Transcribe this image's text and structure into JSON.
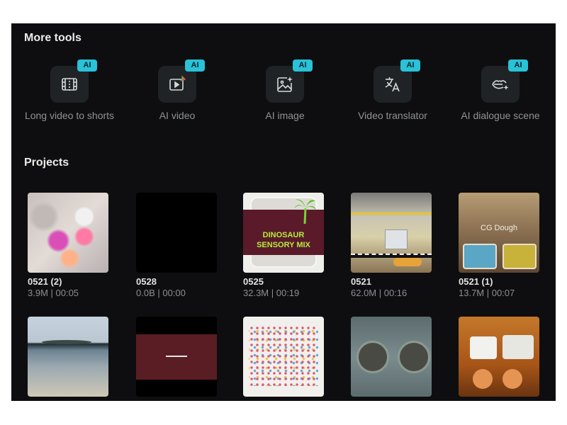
{
  "more_tools": {
    "title": "More tools",
    "items": [
      {
        "badge": "AI",
        "icon": "film-scissors-icon",
        "label": "Long video to shorts"
      },
      {
        "badge": "AI",
        "icon": "play-sparkle-icon",
        "label": "AI video"
      },
      {
        "badge": "AI",
        "icon": "image-sparkle-icon",
        "label": "AI image"
      },
      {
        "badge": "AI",
        "icon": "translate-icon",
        "label": "Video translator"
      },
      {
        "badge": "AI",
        "icon": "lips-sparkle-icon",
        "label": "AI dialogue scene"
      }
    ]
  },
  "projects": {
    "title": "Projects",
    "items": [
      {
        "name": "0521 (2)",
        "meta": "3.9M | 00:05"
      },
      {
        "name": "0528",
        "meta": "0.0B | 00:00"
      },
      {
        "name": "0525",
        "meta": "32.3M | 00:19",
        "thumb_text": [
          "DINOSAUR",
          "SENSORY MIX"
        ]
      },
      {
        "name": "0521",
        "meta": "62.0M | 00:16"
      },
      {
        "name": "0521 (1)",
        "meta": "13.7M | 00:07",
        "thumb_text": [
          "CG Dough"
        ]
      },
      {},
      {},
      {},
      {},
      {}
    ]
  },
  "colors": {
    "panel_bg": "#0e0e10",
    "tool_box_bg": "#1f2326",
    "ai_badge": "#29c2d8",
    "title_text": "#ececec",
    "muted_text": "#8f9295"
  }
}
